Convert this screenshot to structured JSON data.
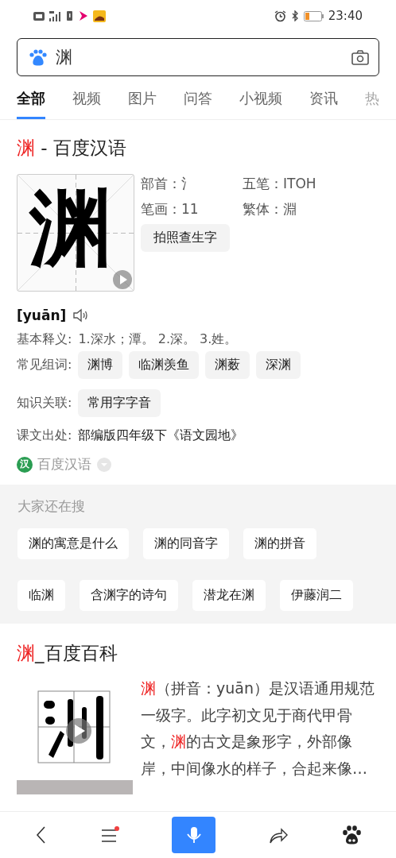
{
  "status_bar": {
    "time": "23:40"
  },
  "search": {
    "value": "渊"
  },
  "tabs": [
    {
      "label": "全部",
      "selected": true
    },
    {
      "label": "视频",
      "selected": false
    },
    {
      "label": "图片",
      "selected": false
    },
    {
      "label": "问答",
      "selected": false
    },
    {
      "label": "小视频",
      "selected": false
    },
    {
      "label": "资讯",
      "selected": false
    },
    {
      "label": "热",
      "selected": false
    }
  ],
  "dictionary": {
    "headword": "渊",
    "title_rest": " - 百度汉语",
    "glyph": "渊",
    "facts": [
      {
        "label": "部首：",
        "value": "氵"
      },
      {
        "label": "五笔：",
        "value": "ITOH"
      },
      {
        "label": "笔画：",
        "value": "11"
      },
      {
        "label": "繁体：",
        "value": "淵"
      }
    ],
    "photo_button": "拍照查生字",
    "pinyin": "[yuān]",
    "meaning_label": "基本释义:",
    "meaning": "1.深水；潭。 2.深。 3.姓。",
    "words_label": "常见组词:",
    "words": [
      "渊博",
      "临渊羡鱼",
      "渊薮",
      "深渊"
    ],
    "knowledge_label": "知识关联:",
    "knowledge": [
      "常用字字音"
    ],
    "textbook_label": "课文出处:",
    "textbook": "部编版四年级下《语文园地》",
    "source_badge": "汉",
    "source": "百度汉语"
  },
  "related": {
    "title": "大家还在搜",
    "rows": [
      [
        "渊的寓意是什么",
        "渊的同音字",
        "渊的拼音"
      ],
      [
        "临渊",
        "含渊字的诗句",
        "潜龙在渊",
        "伊藤润二"
      ]
    ]
  },
  "baike": {
    "headword": "渊",
    "title_rest": "_百度百科",
    "summary": [
      {
        "text": "渊",
        "highlight": true
      },
      {
        "text": "（拼音：yuān）是汉语通用规范一级字。此字初文见于商代甲骨文，",
        "highlight": false
      },
      {
        "text": "渊",
        "highlight": true
      },
      {
        "text": "的古文是象形字，外部像岸，中间像水的样子，合起来像…",
        "highlight": false
      }
    ]
  },
  "bottom_nav": {
    "menu_badge": true
  }
}
